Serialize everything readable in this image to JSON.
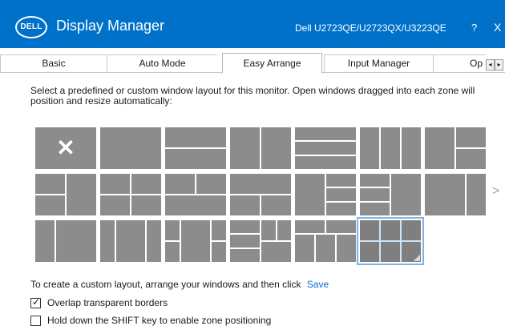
{
  "app": {
    "brand": "DELL",
    "title": "Display Manager",
    "monitor_model": "Dell U2723QE/U2723QX/U3223QE",
    "help_label": "?",
    "close_label": "X",
    "accent_color": "#0071c9"
  },
  "tabs": [
    {
      "label": "Basic",
      "active": false
    },
    {
      "label": "Auto Mode",
      "active": false
    },
    {
      "label": "Easy Arrange",
      "active": true
    },
    {
      "label": "Input Manager",
      "active": false
    },
    {
      "label": "Op",
      "active": false
    }
  ],
  "tab_scroll": {
    "left": "◂",
    "right": "▸"
  },
  "instructions": "Select a predefined or custom window layout for this monitor.  Open windows dragged into each zone will position and resize automatically:",
  "layouts": {
    "selected_index": 19,
    "count": 20,
    "next_page_icon": ">"
  },
  "custom_layout": {
    "text": "To create a custom layout, arrange your windows and then click",
    "save_label": "Save"
  },
  "options": [
    {
      "label": "Overlap transparent borders",
      "checked": true
    },
    {
      "label": "Hold down the SHIFT key to enable zone positioning",
      "checked": false
    }
  ]
}
